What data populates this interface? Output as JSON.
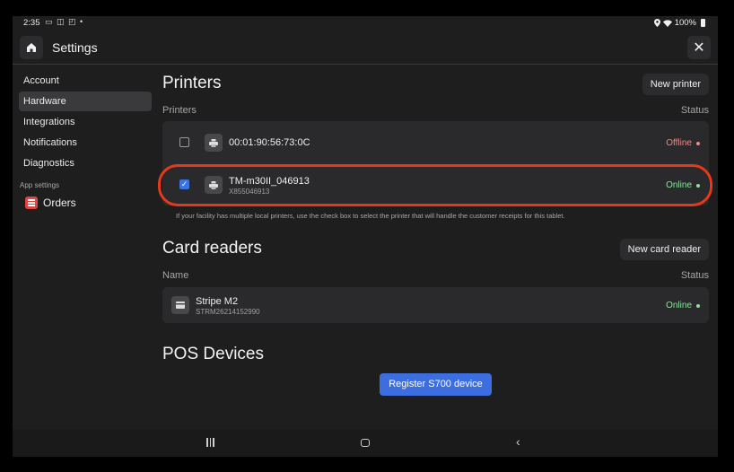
{
  "status_bar": {
    "time": "2:35",
    "notification_icons": "▭ ◫ ◰ •",
    "battery": "100%"
  },
  "header": {
    "title": "Settings",
    "home_icon": "home-icon",
    "close_icon": "close-icon",
    "close_glyph": "✕"
  },
  "sidebar": {
    "items": [
      {
        "label": "Account",
        "active": false
      },
      {
        "label": "Hardware",
        "active": true
      },
      {
        "label": "Integrations",
        "active": false
      },
      {
        "label": "Notifications",
        "active": false
      },
      {
        "label": "Diagnostics",
        "active": false
      }
    ],
    "app_settings_label": "App settings",
    "orders_label": "Orders"
  },
  "printers": {
    "title": "Printers",
    "new_button": "New printer",
    "col_name": "Printers",
    "col_status": "Status",
    "rows": [
      {
        "name": "00:01:90:56:73:0C",
        "sub": "",
        "status": "Offline",
        "checked": false,
        "status_color": "#e88a8a"
      },
      {
        "name": "TM-m30II_046913",
        "sub": "X855046913",
        "status": "Online",
        "checked": true,
        "status_color": "#8ee0a0"
      }
    ],
    "hint": "If your facility has multiple local printers, use the check box to select the printer that will handle the customer receipts for this tablet."
  },
  "card_readers": {
    "title": "Card readers",
    "new_button": "New card reader",
    "col_name": "Name",
    "col_status": "Status",
    "rows": [
      {
        "name": "Stripe M2",
        "sub": "STRM26214152990",
        "status": "Online",
        "status_color": "#8ee0a0"
      }
    ]
  },
  "pos_devices": {
    "title": "POS Devices",
    "register_button": "Register S700 device"
  },
  "colors": {
    "accent": "#3c6ee0",
    "highlight": "#e5391b",
    "online": "#8ee0a0",
    "offline": "#e88a8a"
  }
}
